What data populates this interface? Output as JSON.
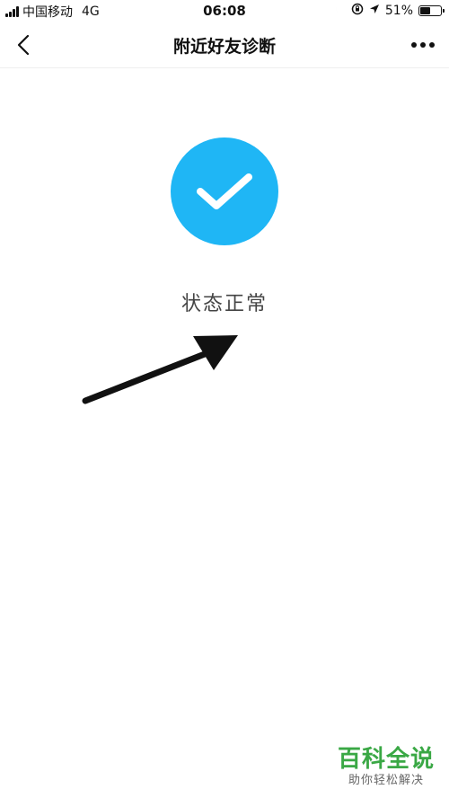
{
  "status_bar": {
    "carrier": "中国移动",
    "network": "4G",
    "time": "06:08",
    "battery": "51%",
    "battery_level": 0.51,
    "icons": [
      "signal-icon",
      "moon-icon",
      "rotation-lock-icon",
      "location-arrow-icon",
      "battery-icon"
    ]
  },
  "nav": {
    "title": "附近好友诊断",
    "back_icon": "chevron-left-icon",
    "more_icon": "more-dots-icon"
  },
  "main": {
    "status_icon": "checkmark-icon",
    "status_text": "状态正常",
    "accent_color": "#1fb6f5"
  },
  "watermark": {
    "title": "百科全说",
    "subtitle": "助你轻松解决",
    "color": "#3aa845"
  }
}
